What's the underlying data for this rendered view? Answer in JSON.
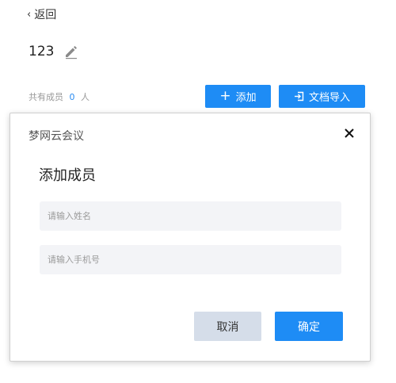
{
  "header": {
    "back_label": "返回",
    "group_name": "123",
    "member_prefix": "共有成员",
    "member_count": "0",
    "member_suffix": "人"
  },
  "toolbar": {
    "add_label": "添加",
    "import_label": "文档导入"
  },
  "dialog": {
    "app_title": "梦网云会议",
    "heading": "添加成员",
    "name_placeholder": "请输入姓名",
    "phone_placeholder": "请输入手机号",
    "cancel_label": "取消",
    "confirm_label": "确定"
  },
  "colors": {
    "accent": "#1e8cf5",
    "cancel_bg": "#d5dde9",
    "input_bg": "#f3f4f7"
  },
  "icons": [
    "chevron-left-icon",
    "pencil-icon",
    "plus-icon",
    "import-icon",
    "close-icon"
  ]
}
